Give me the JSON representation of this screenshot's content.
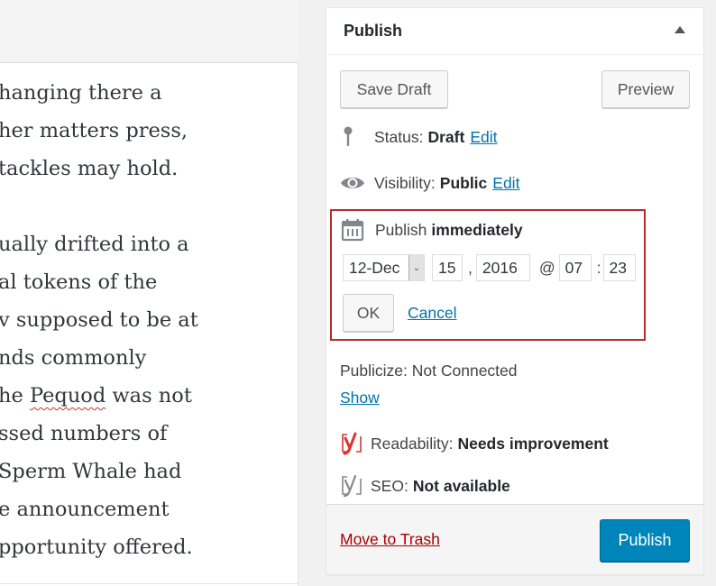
{
  "editor": {
    "lines": [
      "hanging there a",
      "her matters press,",
      " tackles may hold.",
      "",
      "ually drifted into a",
      "al tokens of the",
      "v supposed to be at",
      "nds commonly",
      "he ",
      "ssed numbers of",
      " Sperm Whale had",
      "e announcement",
      "pportunity offered."
    ],
    "misspelled_line": {
      "prefix": "he ",
      "word": "Pequod",
      "suffix": " was not"
    }
  },
  "publish_box": {
    "title": "Publish",
    "toggle_icon": "triangle-up-icon",
    "save_draft_label": "Save Draft",
    "preview_label": "Preview",
    "status": {
      "icon": "pin-icon",
      "label": "Status:",
      "value": "Draft",
      "edit_label": "Edit"
    },
    "visibility": {
      "icon": "eye-icon",
      "label": "Visibility:",
      "value": "Public",
      "edit_label": "Edit"
    },
    "schedule": {
      "icon": "calendar-icon",
      "label": "Publish",
      "value": "immediately",
      "month": "12-Dec",
      "day": "15",
      "comma": ",",
      "year": "2016",
      "at": "@",
      "hour": "07",
      "colon": ":",
      "minute": "23",
      "ok_label": "OK",
      "cancel_label": "Cancel"
    },
    "publicize": {
      "text": "Publicize: Not Connected",
      "show_label": "Show"
    },
    "readability": {
      "icon": "yoast-readability-icon",
      "label": "Readability:",
      "value": "Needs improvement",
      "color": "#dc3232"
    },
    "seo": {
      "icon": "yoast-seo-icon",
      "label": "SEO:",
      "value": "Not available",
      "color": "#888888"
    },
    "trash_label": "Move to Trash",
    "publish_label": "Publish",
    "accent_color": "#0085ba",
    "highlight_border_color": "#b32d2e"
  }
}
